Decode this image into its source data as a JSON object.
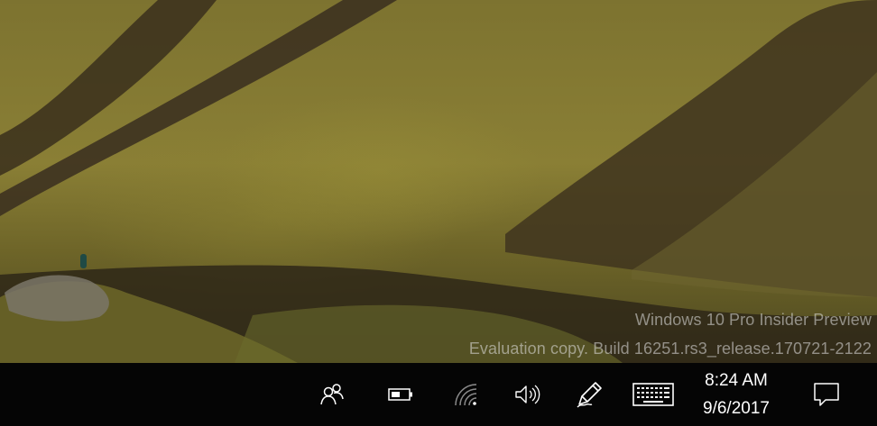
{
  "watermark": {
    "line1": "Windows 10 Pro Insider Preview",
    "line2": "Evaluation copy. Build 16251.rs3_release.170721-2122"
  },
  "taskbar": {
    "tray_icons": [
      "people-icon",
      "battery-icon",
      "wifi-icon",
      "volume-icon",
      "pen-workspace-icon",
      "touch-keyboard-icon"
    ],
    "clock": {
      "time": "8:24 AM",
      "date": "9/6/2017"
    },
    "action_center_icon": "notification-icon"
  },
  "colors": {
    "taskbar_bg": "#050505",
    "icon_color": "#ffffff",
    "watermark_color": "#e1e1e1"
  }
}
